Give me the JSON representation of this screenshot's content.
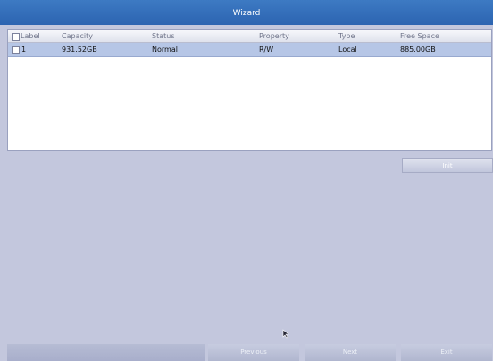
{
  "window": {
    "title": "Wizard"
  },
  "table": {
    "headers": {
      "label": "Label",
      "capacity": "Capacity",
      "status": "Status",
      "property": "Property",
      "type": "Type",
      "free_space": "Free Space"
    },
    "rows": [
      {
        "label": "1",
        "capacity": "931.52GB",
        "status": "Normal",
        "property": "R/W",
        "type": "Local",
        "free_space": "885.00GB",
        "selected": true
      }
    ]
  },
  "actions": {
    "init_label": "Init"
  },
  "footer": {
    "previous_label": "Previous",
    "next_label": "Next",
    "exit_label": "Exit"
  },
  "colors": {
    "title_bar": "#2f68b4",
    "background": "#c3c7dd",
    "selected_row": "#b6c6e6"
  }
}
